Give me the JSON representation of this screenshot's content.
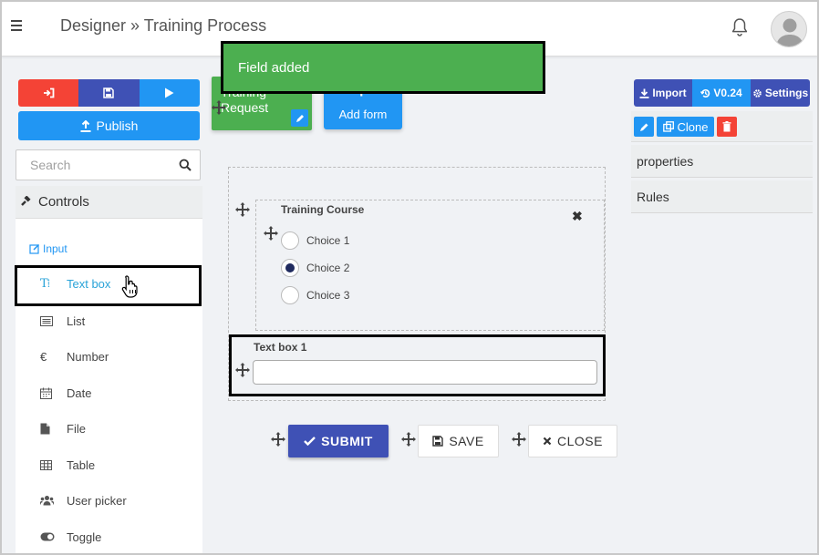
{
  "header": {
    "title": "Designer » Training Process",
    "menu_icon": "hamburger-icon",
    "bell_icon": "bell-icon",
    "avatar_icon": "user-avatar-icon"
  },
  "toast": {
    "message": "Field added"
  },
  "left": {
    "actions": [
      {
        "icon": "sign-in-icon",
        "color": "#f44336"
      },
      {
        "icon": "save-icon",
        "color": "#3f51b5"
      },
      {
        "icon": "play-icon",
        "color": "#2196f3"
      }
    ],
    "publish_label": "Publish",
    "search_placeholder": "Search",
    "controls_title": "Controls",
    "category_label": "Input",
    "controls": [
      {
        "label": "Text box",
        "icon": "text-box-icon"
      },
      {
        "label": "List",
        "icon": "list-icon"
      },
      {
        "label": "Number",
        "icon": "euro-icon"
      },
      {
        "label": "Date",
        "icon": "calendar-icon"
      },
      {
        "label": "File",
        "icon": "file-icon"
      },
      {
        "label": "Table",
        "icon": "table-icon"
      },
      {
        "label": "User picker",
        "icon": "users-icon"
      },
      {
        "label": "Toggle",
        "icon": "toggle-icon"
      }
    ]
  },
  "center": {
    "form_card_label": "Training Request",
    "add_form_label": "Add form",
    "radio_group": {
      "title": "Training Course",
      "options": [
        "Choice 1",
        "Choice 2",
        "Choice 3"
      ],
      "selected": "Choice 2"
    },
    "textbox": {
      "label": "Text box 1",
      "value": ""
    },
    "submit_label": "SUBMIT",
    "save_label": "SAVE",
    "close_label": "CLOSE"
  },
  "right": {
    "import_label": "Import",
    "version_label": "V0.24",
    "settings_label": "Settings",
    "clone_label": "Clone",
    "properties_label": "properties",
    "rules_label": "Rules"
  },
  "colors": {
    "green": "#4caf50",
    "indigo": "#3f51b5",
    "blue": "#2196f3",
    "red": "#f44336",
    "active_control": "#29a3d8"
  }
}
